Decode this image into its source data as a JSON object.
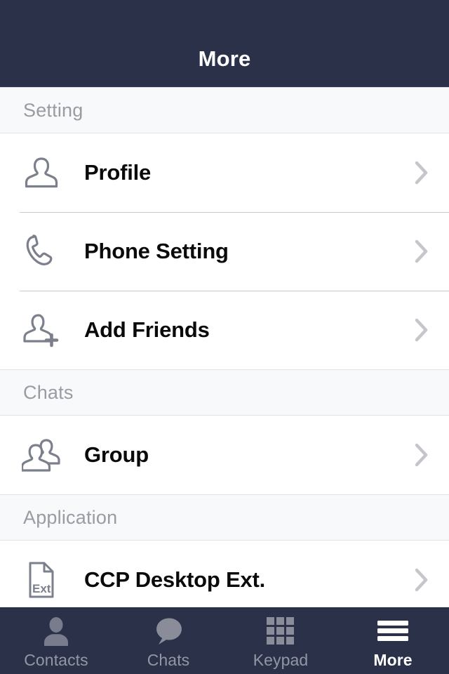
{
  "navbar": {
    "title": "More"
  },
  "colors": {
    "nav_background": "#2a3148",
    "nav_title": "#ffffff",
    "section_header_background": "#f8f9fb",
    "section_header_text": "#9a9ba3",
    "row_background": "#ffffff",
    "row_text": "#0a0a0a",
    "row_icon": "#7c7f8c",
    "chevron": "#c4c6cc",
    "separator": "#c8c9cd",
    "tab_inactive": "#9497a3",
    "tab_active": "#ffffff"
  },
  "sections": [
    {
      "header": "Setting",
      "rows": [
        {
          "label": "Profile",
          "icon": "person-outline-icon",
          "chevron": "chevron-right-icon"
        },
        {
          "label": "Phone Setting",
          "icon": "phone-handset-icon",
          "chevron": "chevron-right-icon"
        },
        {
          "label": "Add Friends",
          "icon": "person-add-icon",
          "chevron": "chevron-right-icon"
        }
      ]
    },
    {
      "header": "Chats",
      "rows": [
        {
          "label": "Group",
          "icon": "people-group-icon",
          "chevron": "chevron-right-icon"
        }
      ]
    },
    {
      "header": "Application",
      "rows": [
        {
          "label": "CCP Desktop Ext.",
          "icon": "document-ext-icon",
          "icon_text": "Ext.",
          "chevron": "chevron-right-icon"
        }
      ]
    }
  ],
  "tabbar": {
    "tabs": [
      {
        "label": "Contacts",
        "icon": "person-filled-icon",
        "active": false
      },
      {
        "label": "Chats",
        "icon": "speech-bubble-icon",
        "active": false
      },
      {
        "label": "Keypad",
        "icon": "grid-keypad-icon",
        "active": false
      },
      {
        "label": "More",
        "icon": "hamburger-menu-icon",
        "active": true
      }
    ]
  }
}
